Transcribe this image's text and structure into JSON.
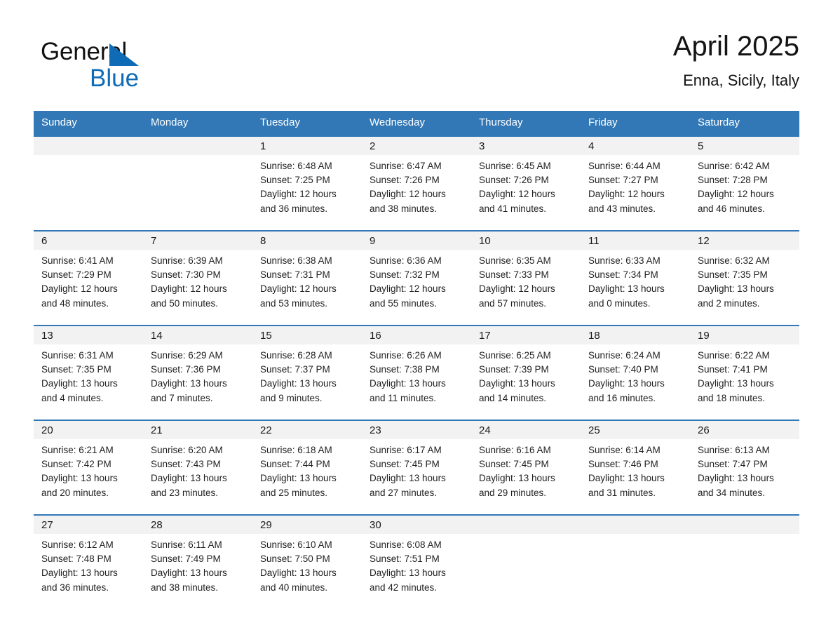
{
  "logo": {
    "word_one": "General",
    "word_two": "Blue",
    "triangle_color": "#0f6bb5"
  },
  "header": {
    "title": "April 2025",
    "subtitle": "Enna, Sicily, Italy"
  },
  "theme": {
    "header_blue": "#3278b6",
    "band_gray": "#f2f2f2",
    "text": "#1f1f1f"
  },
  "calendar": {
    "weekday_headers": [
      "Sunday",
      "Monday",
      "Tuesday",
      "Wednesday",
      "Thursday",
      "Friday",
      "Saturday"
    ],
    "weeks": [
      [
        {
          "day": "",
          "sunrise": "",
          "sunset": "",
          "daylight": ""
        },
        {
          "day": "",
          "sunrise": "",
          "sunset": "",
          "daylight": ""
        },
        {
          "day": "1",
          "sunrise": "Sunrise: 6:48 AM",
          "sunset": "Sunset: 7:25 PM",
          "daylight": "Daylight: 12 hours and 36 minutes."
        },
        {
          "day": "2",
          "sunrise": "Sunrise: 6:47 AM",
          "sunset": "Sunset: 7:26 PM",
          "daylight": "Daylight: 12 hours and 38 minutes."
        },
        {
          "day": "3",
          "sunrise": "Sunrise: 6:45 AM",
          "sunset": "Sunset: 7:26 PM",
          "daylight": "Daylight: 12 hours and 41 minutes."
        },
        {
          "day": "4",
          "sunrise": "Sunrise: 6:44 AM",
          "sunset": "Sunset: 7:27 PM",
          "daylight": "Daylight: 12 hours and 43 minutes."
        },
        {
          "day": "5",
          "sunrise": "Sunrise: 6:42 AM",
          "sunset": "Sunset: 7:28 PM",
          "daylight": "Daylight: 12 hours and 46 minutes."
        }
      ],
      [
        {
          "day": "6",
          "sunrise": "Sunrise: 6:41 AM",
          "sunset": "Sunset: 7:29 PM",
          "daylight": "Daylight: 12 hours and 48 minutes."
        },
        {
          "day": "7",
          "sunrise": "Sunrise: 6:39 AM",
          "sunset": "Sunset: 7:30 PM",
          "daylight": "Daylight: 12 hours and 50 minutes."
        },
        {
          "day": "8",
          "sunrise": "Sunrise: 6:38 AM",
          "sunset": "Sunset: 7:31 PM",
          "daylight": "Daylight: 12 hours and 53 minutes."
        },
        {
          "day": "9",
          "sunrise": "Sunrise: 6:36 AM",
          "sunset": "Sunset: 7:32 PM",
          "daylight": "Daylight: 12 hours and 55 minutes."
        },
        {
          "day": "10",
          "sunrise": "Sunrise: 6:35 AM",
          "sunset": "Sunset: 7:33 PM",
          "daylight": "Daylight: 12 hours and 57 minutes."
        },
        {
          "day": "11",
          "sunrise": "Sunrise: 6:33 AM",
          "sunset": "Sunset: 7:34 PM",
          "daylight": "Daylight: 13 hours and 0 minutes."
        },
        {
          "day": "12",
          "sunrise": "Sunrise: 6:32 AM",
          "sunset": "Sunset: 7:35 PM",
          "daylight": "Daylight: 13 hours and 2 minutes."
        }
      ],
      [
        {
          "day": "13",
          "sunrise": "Sunrise: 6:31 AM",
          "sunset": "Sunset: 7:35 PM",
          "daylight": "Daylight: 13 hours and 4 minutes."
        },
        {
          "day": "14",
          "sunrise": "Sunrise: 6:29 AM",
          "sunset": "Sunset: 7:36 PM",
          "daylight": "Daylight: 13 hours and 7 minutes."
        },
        {
          "day": "15",
          "sunrise": "Sunrise: 6:28 AM",
          "sunset": "Sunset: 7:37 PM",
          "daylight": "Daylight: 13 hours and 9 minutes."
        },
        {
          "day": "16",
          "sunrise": "Sunrise: 6:26 AM",
          "sunset": "Sunset: 7:38 PM",
          "daylight": "Daylight: 13 hours and 11 minutes."
        },
        {
          "day": "17",
          "sunrise": "Sunrise: 6:25 AM",
          "sunset": "Sunset: 7:39 PM",
          "daylight": "Daylight: 13 hours and 14 minutes."
        },
        {
          "day": "18",
          "sunrise": "Sunrise: 6:24 AM",
          "sunset": "Sunset: 7:40 PM",
          "daylight": "Daylight: 13 hours and 16 minutes."
        },
        {
          "day": "19",
          "sunrise": "Sunrise: 6:22 AM",
          "sunset": "Sunset: 7:41 PM",
          "daylight": "Daylight: 13 hours and 18 minutes."
        }
      ],
      [
        {
          "day": "20",
          "sunrise": "Sunrise: 6:21 AM",
          "sunset": "Sunset: 7:42 PM",
          "daylight": "Daylight: 13 hours and 20 minutes."
        },
        {
          "day": "21",
          "sunrise": "Sunrise: 6:20 AM",
          "sunset": "Sunset: 7:43 PM",
          "daylight": "Daylight: 13 hours and 23 minutes."
        },
        {
          "day": "22",
          "sunrise": "Sunrise: 6:18 AM",
          "sunset": "Sunset: 7:44 PM",
          "daylight": "Daylight: 13 hours and 25 minutes."
        },
        {
          "day": "23",
          "sunrise": "Sunrise: 6:17 AM",
          "sunset": "Sunset: 7:45 PM",
          "daylight": "Daylight: 13 hours and 27 minutes."
        },
        {
          "day": "24",
          "sunrise": "Sunrise: 6:16 AM",
          "sunset": "Sunset: 7:45 PM",
          "daylight": "Daylight: 13 hours and 29 minutes."
        },
        {
          "day": "25",
          "sunrise": "Sunrise: 6:14 AM",
          "sunset": "Sunset: 7:46 PM",
          "daylight": "Daylight: 13 hours and 31 minutes."
        },
        {
          "day": "26",
          "sunrise": "Sunrise: 6:13 AM",
          "sunset": "Sunset: 7:47 PM",
          "daylight": "Daylight: 13 hours and 34 minutes."
        }
      ],
      [
        {
          "day": "27",
          "sunrise": "Sunrise: 6:12 AM",
          "sunset": "Sunset: 7:48 PM",
          "daylight": "Daylight: 13 hours and 36 minutes."
        },
        {
          "day": "28",
          "sunrise": "Sunrise: 6:11 AM",
          "sunset": "Sunset: 7:49 PM",
          "daylight": "Daylight: 13 hours and 38 minutes."
        },
        {
          "day": "29",
          "sunrise": "Sunrise: 6:10 AM",
          "sunset": "Sunset: 7:50 PM",
          "daylight": "Daylight: 13 hours and 40 minutes."
        },
        {
          "day": "30",
          "sunrise": "Sunrise: 6:08 AM",
          "sunset": "Sunset: 7:51 PM",
          "daylight": "Daylight: 13 hours and 42 minutes."
        },
        {
          "day": "",
          "sunrise": "",
          "sunset": "",
          "daylight": ""
        },
        {
          "day": "",
          "sunrise": "",
          "sunset": "",
          "daylight": ""
        },
        {
          "day": "",
          "sunrise": "",
          "sunset": "",
          "daylight": ""
        }
      ]
    ]
  }
}
